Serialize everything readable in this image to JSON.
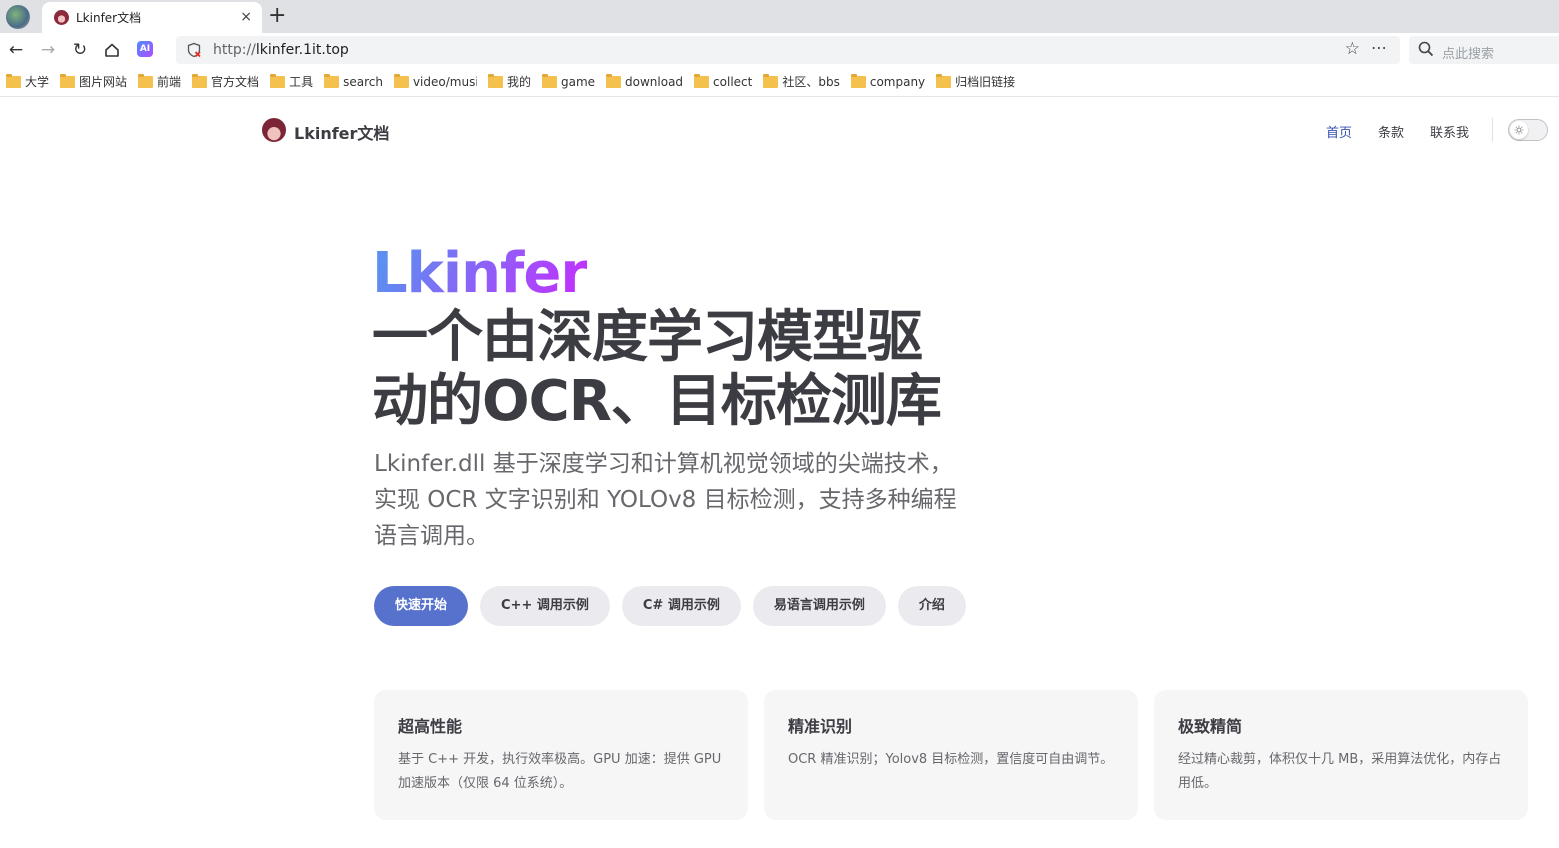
{
  "browser": {
    "tab": {
      "title": "Lkinfer文档",
      "close_glyph": "×"
    },
    "new_tab_glyph": "+",
    "url_scheme": "http://",
    "url_host": "lkinfer.1it.top",
    "search_placeholder": "点此搜索",
    "ai_label": "AI",
    "bookmarks": [
      {
        "label": "大学"
      },
      {
        "label": "图片网站"
      },
      {
        "label": "前端"
      },
      {
        "label": "官方文档"
      },
      {
        "label": "工具"
      },
      {
        "label": "search"
      },
      {
        "label": "video/music"
      },
      {
        "label": "我的"
      },
      {
        "label": "game"
      },
      {
        "label": "download"
      },
      {
        "label": "collect"
      },
      {
        "label": "社区、bbs"
      },
      {
        "label": "company"
      },
      {
        "label": "归档旧链接"
      }
    ]
  },
  "site": {
    "title": "Lkinfer文档",
    "nav": [
      {
        "label": "首页",
        "active": true
      },
      {
        "label": "条款",
        "active": false
      },
      {
        "label": "联系我",
        "active": false
      }
    ]
  },
  "hero": {
    "name": "Lkinfer",
    "text": "一个由深度学习模型驱动的OCR、目标检测库",
    "tagline": "Lkinfer.dll 基于深度学习和计算机视觉领域的尖端技术，实现 OCR 文字识别和 YOLOv8 目标检测，支持多种编程语言调用。",
    "actions": [
      {
        "label": "快速开始",
        "theme": "brand"
      },
      {
        "label": "C++ 调用示例",
        "theme": "alt"
      },
      {
        "label": "C# 调用示例",
        "theme": "alt"
      },
      {
        "label": "易语言调用示例",
        "theme": "alt"
      },
      {
        "label": "介绍",
        "theme": "alt"
      }
    ]
  },
  "features": [
    {
      "title": "超高性能",
      "details": "基于 C++ 开发，执行效率极高。GPU 加速：提供 GPU 加速版本（仅限 64 位系统）。"
    },
    {
      "title": "精准识别",
      "details": "OCR 精准识别；Yolov8 目标检测，置信度可自由调节。"
    },
    {
      "title": "极致精简",
      "details": "经过精心裁剪，体积仅十几 MB，采用算法优化，内存占用低。"
    }
  ],
  "colors": {
    "brand": "#5672cd",
    "active_link": "#3451b2",
    "gradient_start": "#5b8ff0",
    "gradient_end": "#bd34fe"
  }
}
